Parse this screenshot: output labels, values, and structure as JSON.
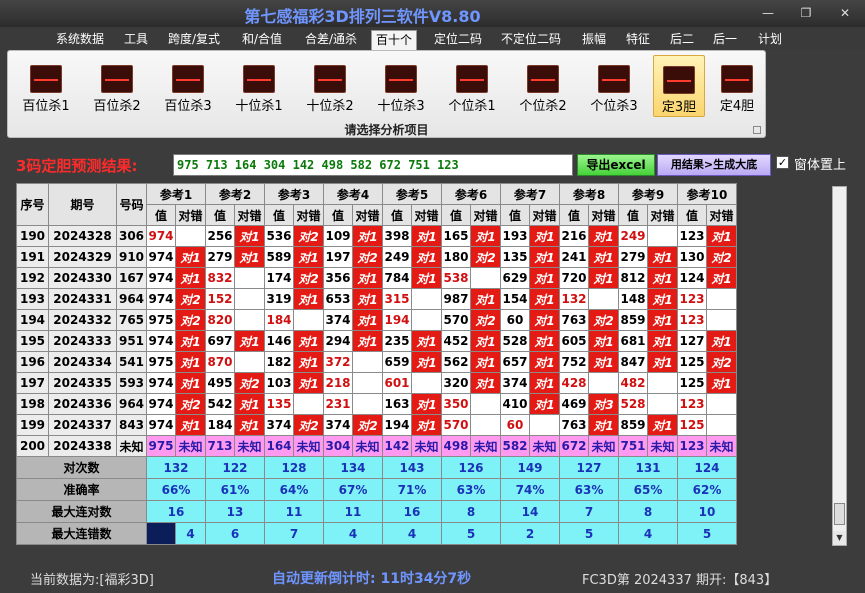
{
  "window": {
    "title": "第七感福彩3D排列三软件V8.80",
    "btn_min": "—",
    "btn_max": "❐",
    "btn_close": "✕"
  },
  "menu": [
    "系统数据",
    "工具",
    "跨度/复式",
    "和/合值",
    "合差/通杀",
    "百十个",
    "定位二码",
    "不定位二码",
    "振幅",
    "特征",
    "后二",
    "后一",
    "计划"
  ],
  "menu_active_index": 5,
  "ribbon": {
    "items": [
      "百位杀1",
      "百位杀2",
      "百位杀3",
      "十位杀1",
      "十位杀2",
      "十位杀3",
      "个位杀1",
      "个位杀2",
      "个位杀3",
      "定3胆",
      "定4胆"
    ],
    "selected_index": 9,
    "caption": "请选择分析项目"
  },
  "result": {
    "label": "3码定胆预测结果:",
    "value": "975 713 164 304 142 498 582 672 751 123",
    "btn_excel": "导出excel",
    "btn_generate": "用结果>生成大底",
    "ontop_label": "窗体置上",
    "ontop_checked": "✓"
  },
  "table": {
    "h_seq": "序号",
    "h_period": "期号",
    "h_number": "号码",
    "refs": [
      "参考1",
      "参考2",
      "参考3",
      "参考4",
      "参考5",
      "参考6",
      "参考7",
      "参考8",
      "参考9",
      "参考10"
    ],
    "sub_value": "值",
    "sub_hit": "对错",
    "rows": [
      {
        "seq": "190",
        "period": "2024328",
        "number": "306",
        "cells": [
          [
            "974",
            ""
          ],
          [
            "256",
            "对1"
          ],
          [
            "536",
            "对2"
          ],
          [
            "109",
            "对1"
          ],
          [
            "398",
            "对1"
          ],
          [
            "165",
            "对1"
          ],
          [
            "193",
            "对1"
          ],
          [
            "216",
            "对1"
          ],
          [
            "249",
            ""
          ],
          [
            "123",
            "对1"
          ]
        ]
      },
      {
        "seq": "191",
        "period": "2024329",
        "number": "910",
        "cells": [
          [
            "974",
            "对1"
          ],
          [
            "279",
            "对1"
          ],
          [
            "589",
            "对1"
          ],
          [
            "197",
            "对2"
          ],
          [
            "249",
            "对1"
          ],
          [
            "180",
            "对2"
          ],
          [
            "135",
            "对1"
          ],
          [
            "241",
            "对1"
          ],
          [
            "279",
            "对1"
          ],
          [
            "130",
            "对2"
          ]
        ]
      },
      {
        "seq": "192",
        "period": "2024330",
        "number": "167",
        "cells": [
          [
            "974",
            "对1"
          ],
          [
            "832",
            ""
          ],
          [
            "174",
            "对2"
          ],
          [
            "356",
            "对1"
          ],
          [
            "784",
            "对1"
          ],
          [
            "538",
            ""
          ],
          [
            "629",
            "对1"
          ],
          [
            "720",
            "对1"
          ],
          [
            "812",
            "对1"
          ],
          [
            "124",
            "对1"
          ]
        ]
      },
      {
        "seq": "193",
        "period": "2024331",
        "number": "964",
        "cells": [
          [
            "974",
            "对2"
          ],
          [
            "152",
            ""
          ],
          [
            "319",
            "对1"
          ],
          [
            "653",
            "对1"
          ],
          [
            "315",
            ""
          ],
          [
            "987",
            "对1"
          ],
          [
            "154",
            "对1"
          ],
          [
            "132",
            ""
          ],
          [
            "148",
            "对1"
          ],
          [
            "123",
            ""
          ]
        ]
      },
      {
        "seq": "194",
        "period": "2024332",
        "number": "765",
        "cells": [
          [
            "975",
            "对2"
          ],
          [
            "820",
            ""
          ],
          [
            "184",
            ""
          ],
          [
            "374",
            "对1"
          ],
          [
            "194",
            ""
          ],
          [
            "570",
            "对2"
          ],
          [
            "60",
            "对1"
          ],
          [
            "763",
            "对2"
          ],
          [
            "859",
            "对1"
          ],
          [
            "123",
            ""
          ]
        ]
      },
      {
        "seq": "195",
        "period": "2024333",
        "number": "951",
        "cells": [
          [
            "974",
            "对1"
          ],
          [
            "697",
            "对1"
          ],
          [
            "146",
            "对1"
          ],
          [
            "294",
            "对1"
          ],
          [
            "235",
            "对1"
          ],
          [
            "452",
            "对1"
          ],
          [
            "528",
            "对1"
          ],
          [
            "605",
            "对1"
          ],
          [
            "681",
            "对1"
          ],
          [
            "127",
            "对1"
          ]
        ]
      },
      {
        "seq": "196",
        "period": "2024334",
        "number": "541",
        "cells": [
          [
            "975",
            "对1"
          ],
          [
            "870",
            ""
          ],
          [
            "182",
            "对1"
          ],
          [
            "372",
            ""
          ],
          [
            "659",
            "对1"
          ],
          [
            "562",
            "对1"
          ],
          [
            "657",
            "对1"
          ],
          [
            "752",
            "对1"
          ],
          [
            "847",
            "对1"
          ],
          [
            "125",
            "对2"
          ]
        ]
      },
      {
        "seq": "197",
        "period": "2024335",
        "number": "593",
        "cells": [
          [
            "974",
            "对1"
          ],
          [
            "495",
            "对2"
          ],
          [
            "103",
            "对1"
          ],
          [
            "218",
            ""
          ],
          [
            "601",
            ""
          ],
          [
            "320",
            "对1"
          ],
          [
            "374",
            "对1"
          ],
          [
            "428",
            ""
          ],
          [
            "482",
            ""
          ],
          [
            "125",
            "对1"
          ]
        ]
      },
      {
        "seq": "198",
        "period": "2024336",
        "number": "964",
        "cells": [
          [
            "974",
            "对2"
          ],
          [
            "542",
            "对1"
          ],
          [
            "135",
            ""
          ],
          [
            "231",
            ""
          ],
          [
            "163",
            "对1"
          ],
          [
            "350",
            ""
          ],
          [
            "410",
            "对1"
          ],
          [
            "469",
            "对3"
          ],
          [
            "528",
            ""
          ],
          [
            "123",
            ""
          ]
        ]
      },
      {
        "seq": "199",
        "period": "2024337",
        "number": "843",
        "cells": [
          [
            "974",
            "对1"
          ],
          [
            "184",
            "对1"
          ],
          [
            "374",
            "对2"
          ],
          [
            "374",
            "对2"
          ],
          [
            "194",
            "对1"
          ],
          [
            "570",
            ""
          ],
          [
            "60",
            ""
          ],
          [
            "763",
            "对1"
          ],
          [
            "859",
            "对1"
          ],
          [
            "125",
            ""
          ]
        ]
      }
    ],
    "predict_row": {
      "seq": "200",
      "period": "2024338",
      "number": "未知",
      "values": [
        "975",
        "713",
        "164",
        "304",
        "142",
        "498",
        "582",
        "672",
        "751",
        "123"
      ],
      "unknown": "未知"
    },
    "stats": [
      {
        "label": "对次数",
        "values": [
          "132",
          "122",
          "128",
          "134",
          "143",
          "126",
          "149",
          "127",
          "131",
          "124"
        ]
      },
      {
        "label": "准确率",
        "values": [
          "66%",
          "61%",
          "64%",
          "67%",
          "71%",
          "63%",
          "74%",
          "63%",
          "65%",
          "62%"
        ]
      },
      {
        "label": "最大连对数",
        "values": [
          "16",
          "13",
          "11",
          "11",
          "16",
          "8",
          "14",
          "7",
          "8",
          "10"
        ]
      },
      {
        "label": "最大连错数",
        "values": [
          "4",
          "6",
          "7",
          "4",
          "4",
          "5",
          "2",
          "5",
          "4",
          "5"
        ]
      }
    ]
  },
  "status": {
    "left": "当前数据为:[福彩3D]",
    "mid": "自动更新倒计时:  11时34分7秒",
    "right": "FC3D第 2024337 期开:【843】"
  }
}
